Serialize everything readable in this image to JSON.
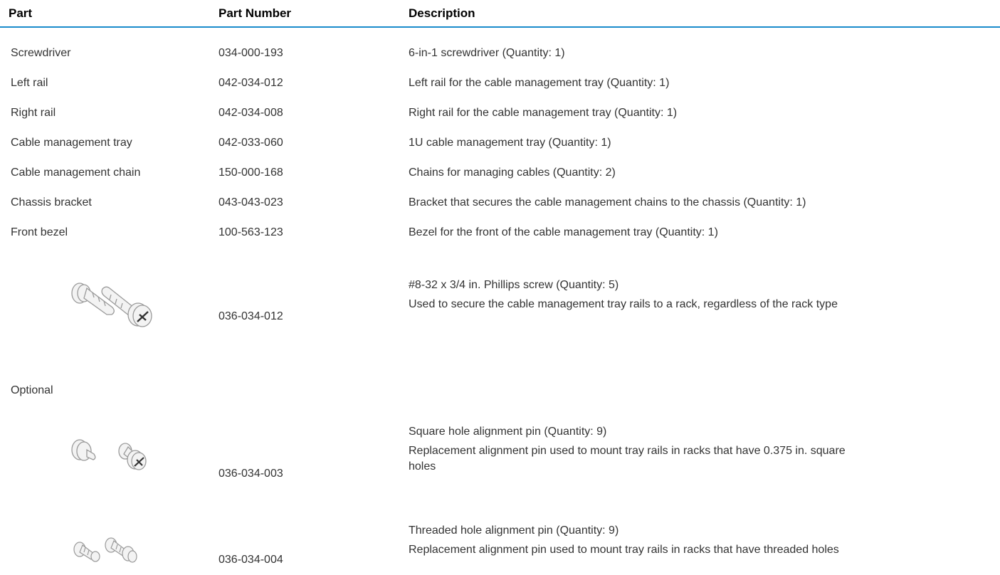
{
  "headers": {
    "part": "Part",
    "part_number": "Part Number",
    "description": "Description"
  },
  "rows": [
    {
      "part": "Screwdriver",
      "number": "034-000-193",
      "desc": "6-in-1 screwdriver (Quantity: 1)"
    },
    {
      "part": "Left rail",
      "number": "042-034-012",
      "desc": "Left rail for the cable management tray (Quantity: 1)"
    },
    {
      "part": "Right rail",
      "number": "042-034-008",
      "desc": "Right rail for the cable management tray (Quantity: 1)"
    },
    {
      "part": "Cable management tray",
      "number": "042-033-060",
      "desc": "1U cable management tray (Quantity: 1)"
    },
    {
      "part": "Cable management chain",
      "number": "150-000-168",
      "desc": "Chains for managing cables (Quantity: 2)"
    },
    {
      "part": "Chassis bracket",
      "number": "043-043-023",
      "desc": "Bracket that secures the cable management chains to the chassis (Quantity: 1)"
    },
    {
      "part": "Front bezel",
      "number": "100-563-123",
      "desc": "Bezel for the front of the cable management tray (Quantity: 1)"
    }
  ],
  "image_rows": [
    {
      "image": "phillips-screw-image",
      "number": "036-034-012",
      "title": "#8-32 x 3/4 in. Phillips screw (Quantity: 5)",
      "desc": "Used to secure the cable management tray rails to a rack, regardless of the rack type"
    },
    {
      "image": "square-hole-pin-image",
      "number": "036-034-003",
      "title": "Square hole alignment pin (Quantity: 9)",
      "desc": "Replacement alignment pin used to mount tray rails in racks that have 0.375 in. square holes"
    },
    {
      "image": "threaded-hole-pin-image",
      "number": "036-034-004",
      "title": "Threaded hole alignment pin (Quantity: 9)",
      "desc": "Replacement alignment pin used to mount tray rails in racks that have threaded holes"
    }
  ],
  "optional_label": "Optional",
  "colors": {
    "header_rule": "#1a8bcb",
    "text": "#333333",
    "header_text": "#000000"
  }
}
